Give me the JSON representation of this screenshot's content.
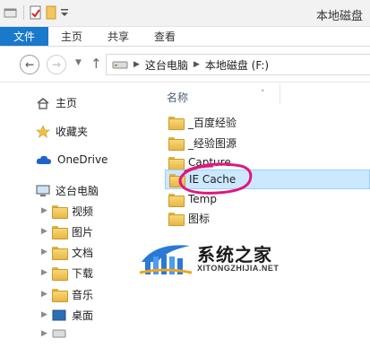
{
  "window": {
    "title": "本地磁盘"
  },
  "ribbon": {
    "file_tab": "文件",
    "tabs": [
      "主页",
      "共享",
      "查看"
    ]
  },
  "address": {
    "crumbs": [
      "这台电脑",
      "本地磁盘 (F:)"
    ]
  },
  "nav": {
    "home": "主页",
    "favorites": "收藏夹",
    "onedrive": "OneDrive",
    "this_pc": "这台电脑",
    "pc_children": [
      "视频",
      "图片",
      "文档",
      "下载",
      "音乐",
      "桌面"
    ]
  },
  "content": {
    "column_name": "名称",
    "items": [
      "_百度经验",
      "_经验图源",
      "Capture",
      "IE Cache",
      "Temp",
      "图标"
    ],
    "selected_index": 3
  },
  "watermark": {
    "text": "系统之家",
    "url": "XITONGZHIJIA.NET"
  },
  "colors": {
    "accent": "#1979ca",
    "selection": "#cce8ff",
    "annotation": "#e0187d"
  }
}
